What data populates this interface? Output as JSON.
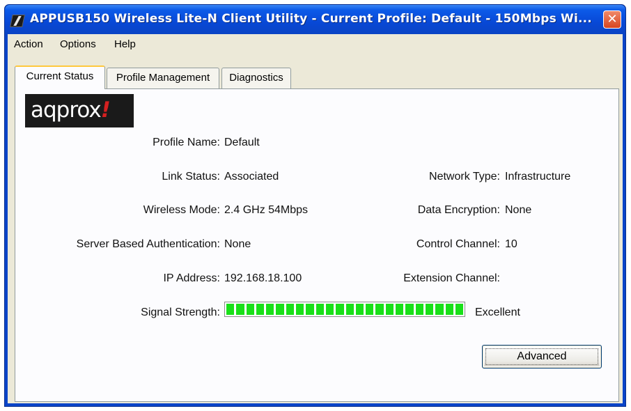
{
  "window": {
    "title": "APPUSB150 Wireless Lite-N Client Utility - Current Profile: Default - 150Mbps Wi...",
    "close_label": "✕"
  },
  "menu": {
    "action": "Action",
    "options": "Options",
    "help": "Help"
  },
  "tabs": [
    {
      "label": "Current Status",
      "active": true
    },
    {
      "label": "Profile Management",
      "active": false
    },
    {
      "label": "Diagnostics",
      "active": false
    }
  ],
  "logo": {
    "text": "aqprox",
    "mark": "!"
  },
  "status": {
    "profile_name_label": "Profile Name:",
    "profile_name_value": "Default",
    "link_status_label": "Link Status:",
    "link_status_value": "Associated",
    "wireless_mode_label": "Wireless Mode:",
    "wireless_mode_value": "2.4 GHz 54Mbps",
    "server_auth_label": "Server Based Authentication:",
    "server_auth_value": "None",
    "ip_address_label": "IP Address:",
    "ip_address_value": "192.168.18.100",
    "signal_strength_label": "Signal Strength:",
    "signal_strength_value": "Excellent",
    "signal_strength_level": 1.0,
    "network_type_label": "Network Type:",
    "network_type_value": "Infrastructure",
    "data_encryption_label": "Data Encryption:",
    "data_encryption_value": "None",
    "control_channel_label": "Control Channel:",
    "control_channel_value": "10",
    "extension_channel_label": "Extension Channel:",
    "extension_channel_value": ""
  },
  "buttons": {
    "advanced": "Advanced"
  },
  "colors": {
    "titlebar": "#0c5ae8",
    "signal": "#19e019",
    "face": "#ece9d8"
  }
}
